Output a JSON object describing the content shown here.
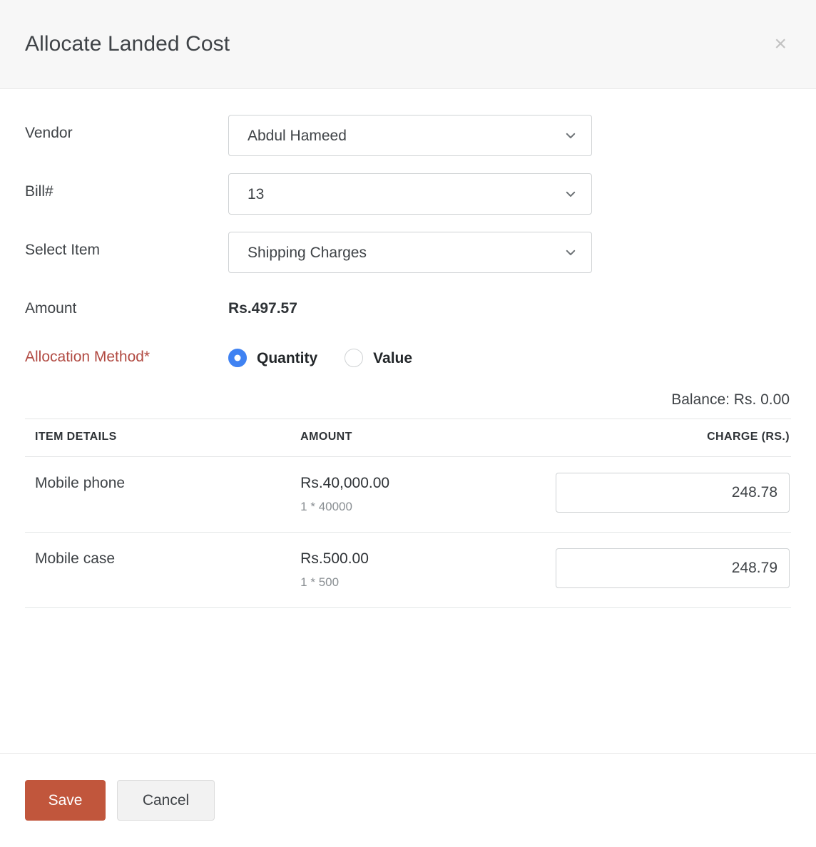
{
  "header": {
    "title": "Allocate Landed Cost",
    "close_label": "×"
  },
  "form": {
    "vendor": {
      "label": "Vendor",
      "value": "Abdul Hameed"
    },
    "bill": {
      "label": "Bill#",
      "value": "13"
    },
    "item": {
      "label": "Select Item",
      "value": "Shipping Charges"
    },
    "amount": {
      "label": "Amount",
      "value": "Rs.497.57"
    },
    "allocation_method": {
      "label": "Allocation Method*",
      "label_color": "#b14a42",
      "selected": "Quantity",
      "options": [
        {
          "label": "Quantity",
          "checked": true
        },
        {
          "label": "Value",
          "checked": false
        }
      ]
    }
  },
  "balance": {
    "text": "Balance: Rs. 0.00"
  },
  "table": {
    "columns": [
      "ITEM DETAILS",
      "AMOUNT",
      "CHARGE (RS.)"
    ],
    "rows": [
      {
        "item": "Mobile phone",
        "amount": "Rs.40,000.00",
        "amount_sub": "1 * 40000",
        "charge": "248.78"
      },
      {
        "item": "Mobile case",
        "amount": "Rs.500.00",
        "amount_sub": "1 * 500",
        "charge": "248.79"
      }
    ]
  },
  "footer": {
    "save_label": "Save",
    "cancel_label": "Cancel"
  },
  "colors": {
    "accent": "#c1563c",
    "radio_selected": "#3f82f2",
    "required_label": "#b14a42",
    "header_bg": "#f7f7f7"
  }
}
